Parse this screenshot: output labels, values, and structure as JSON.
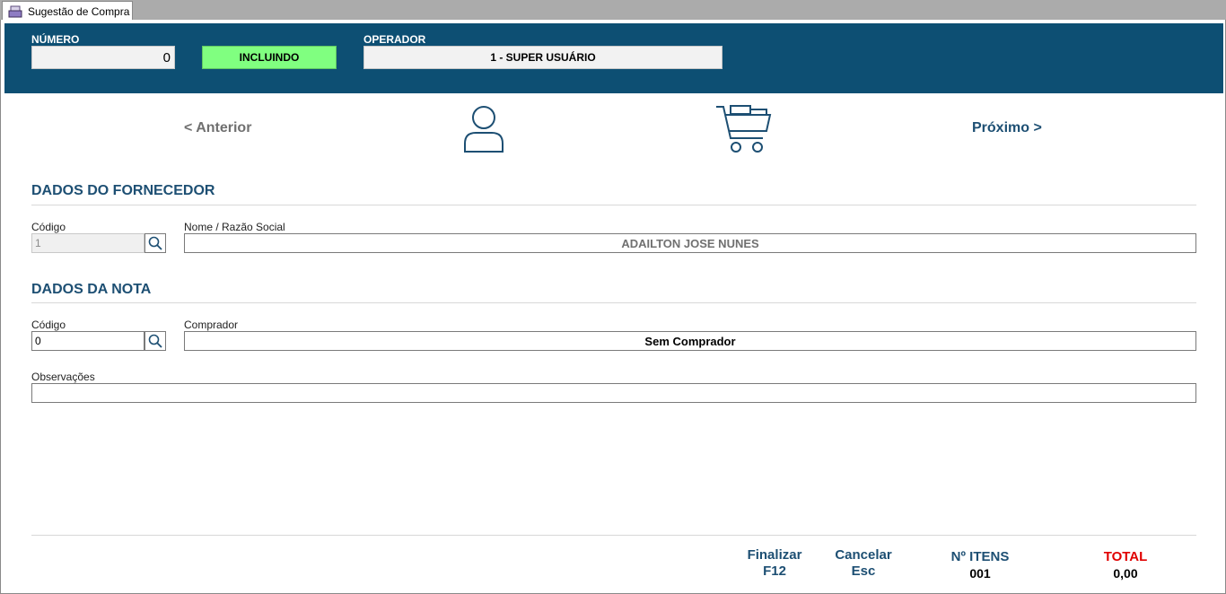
{
  "tab": {
    "title": "Sugestão de Compra",
    "icon": "document-icon"
  },
  "header": {
    "numero_label": "NÚMERO",
    "numero_value": "0",
    "status": "INCLUINDO",
    "operador_label": "OPERADOR",
    "operador_value": "1 - SUPER USUÁRIO"
  },
  "nav": {
    "prev": "<  Anterior",
    "next": "Próximo  >",
    "steps": [
      "user-icon",
      "cart-icon"
    ]
  },
  "fornecedor": {
    "title": "DADOS DO FORNECEDOR",
    "codigo_label": "Código",
    "codigo_value": "1",
    "nome_label": "Nome / Razão Social",
    "nome_value": "ADAILTON JOSE NUNES"
  },
  "nota": {
    "title": "DADOS DA NOTA",
    "codigo_label": "Código",
    "codigo_value": "0",
    "comprador_label": "Comprador",
    "comprador_value": "Sem Comprador",
    "obs_label": "Observações",
    "obs_value": ""
  },
  "footer": {
    "finalizar": "Finalizar",
    "finalizar_key": "F12",
    "cancelar": "Cancelar",
    "cancelar_key": "Esc",
    "itens_label": "Nº ITENS",
    "itens_value": "001",
    "total_label": "TOTAL",
    "total_value": "0,00"
  },
  "colors": {
    "header_bg": "#0d4f73",
    "status_bg": "#80ff80",
    "accent": "#1d4f73",
    "total": "#e00000"
  }
}
